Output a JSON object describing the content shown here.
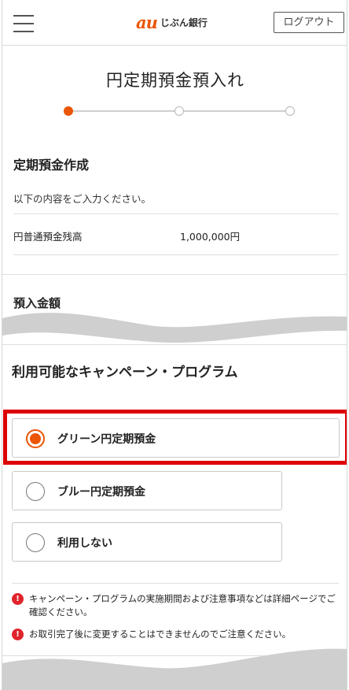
{
  "header": {
    "menu_icon": "hamburger-icon",
    "logo_mark": "au",
    "logo_text": "じぶん銀行",
    "logout_label": "ログアウト"
  },
  "page": {
    "title": "円定期預金預入れ",
    "steps_total": 3,
    "current_step": 1
  },
  "form": {
    "section_title": "定期預金作成",
    "lead": "以下の内容をご入力ください。",
    "balance_label": "円普通預金残高",
    "balance_value": "1,000,000円",
    "deposit_title": "預入金額"
  },
  "campaign": {
    "title": "利用可能なキャンペーン・プログラム",
    "options": [
      {
        "label": "グリーン円定期預金",
        "checked": true
      },
      {
        "label": "ブルー円定期預金",
        "checked": false
      },
      {
        "label": "利用しない",
        "checked": false
      }
    ]
  },
  "notes": [
    {
      "icon": "alert-icon",
      "text": "キャンペーン・プログラムの実施期間および注意事項などは詳細ページでご確認ください。"
    },
    {
      "icon": "alert-icon",
      "text": "お取引完了後に変更することはできませんのでご注意ください。"
    }
  ],
  "colors": {
    "accent": "#eb5505",
    "highlight": "#dd0000",
    "alert": "#e0242c"
  }
}
